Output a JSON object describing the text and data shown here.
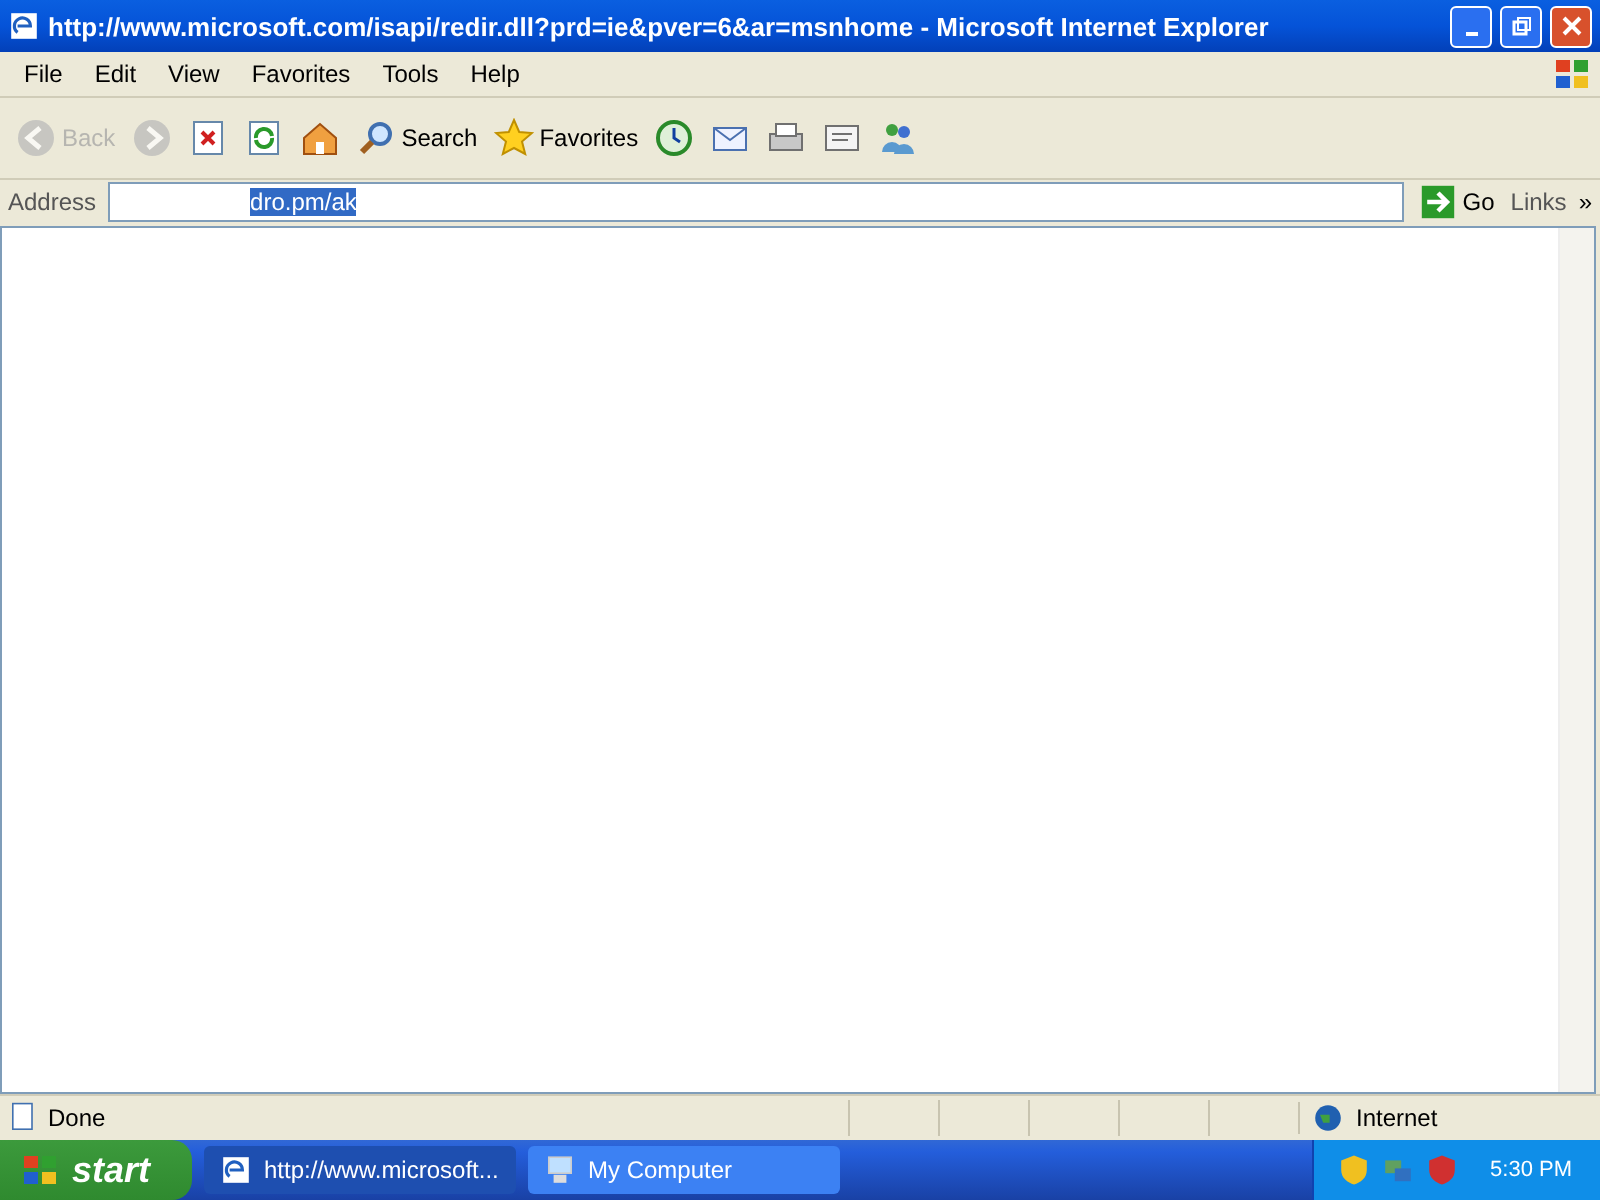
{
  "window": {
    "title": "http://www.microsoft.com/isapi/redir.dll?prd=ie&pver=6&ar=msnhome - Microsoft Internet Explorer"
  },
  "menu": [
    "File",
    "Edit",
    "View",
    "Favorites",
    "Tools",
    "Help"
  ],
  "toolbar": [
    {
      "kind": "back",
      "label": "Back",
      "disabled": true
    },
    {
      "kind": "forward",
      "disabled": true
    },
    {
      "kind": "stop",
      "disabled": false
    },
    {
      "kind": "refresh",
      "disabled": false
    },
    {
      "kind": "home",
      "disabled": false
    },
    {
      "kind": "search",
      "label": "Search",
      "disabled": false
    },
    {
      "kind": "favorites",
      "label": "Favorites",
      "disabled": false
    },
    {
      "kind": "history",
      "disabled": false
    },
    {
      "kind": "mail",
      "disabled": false
    },
    {
      "kind": "print",
      "disabled": false
    },
    {
      "kind": "edit",
      "disabled": false
    },
    {
      "kind": "messenger",
      "disabled": false
    }
  ],
  "address": {
    "label": "Address",
    "value": "dro.pm/ak",
    "value_selected": true,
    "go": "Go",
    "links": "Links",
    "more": "»"
  },
  "status_bar": {
    "text": "Done",
    "zone": "Internet"
  },
  "taskbar": {
    "start": "start",
    "items": [
      {
        "kind": "ie",
        "label": "http://www.microsoft...",
        "selected": true
      },
      {
        "kind": "computer",
        "label": "My Computer",
        "selected": false
      }
    ],
    "clock": "5:30 PM"
  }
}
